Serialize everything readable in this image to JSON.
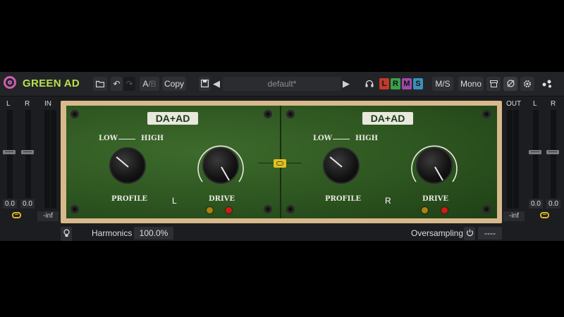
{
  "app": {
    "title": "GREEN AD"
  },
  "toolbar": {
    "ab_a": "A",
    "ab_sep": "/",
    "ab_b": "B",
    "copy_label": "Copy",
    "preset_name": "default*",
    "channels": [
      {
        "label": "L",
        "color": "#c0392b"
      },
      {
        "label": "R",
        "color": "#3aa04a"
      },
      {
        "label": "M",
        "color": "#a04aa8"
      },
      {
        "label": "S",
        "color": "#3a90b8"
      }
    ],
    "ms_label": "M/S",
    "mono_label": "Mono"
  },
  "input_meter": {
    "l": "L",
    "r": "R",
    "in": "IN",
    "l_value": "0.0",
    "r_value": "0.0",
    "in_value": "-inf"
  },
  "output_meter": {
    "out": "OUT",
    "l": "L",
    "r": "R",
    "l_value": "0.0",
    "r_value": "0.0",
    "out_value": "-inf"
  },
  "left_unit": {
    "badge": "DA+AD",
    "low": "LOW",
    "high": "HIGH",
    "profile_label": "PROFILE",
    "drive_label": "DRIVE",
    "channel": "L"
  },
  "right_unit": {
    "badge": "DA+AD",
    "low": "LOW",
    "high": "HIGH",
    "profile_label": "PROFILE",
    "drive_label": "DRIVE",
    "channel": "R"
  },
  "bottom": {
    "harmonics_label": "Harmonics",
    "harmonics_value": "100.0%",
    "oversampling_label": "Oversampling",
    "oversampling_value": "----"
  },
  "icons": [
    "folder-icon",
    "undo-icon",
    "redo-icon",
    "save-icon",
    "prev-preset-icon",
    "next-preset-icon",
    "headphones-icon",
    "archive-icon",
    "bypass-icon",
    "settings-icon",
    "share-icon",
    "link-icon",
    "chain-link-icon",
    "lightbulb-icon",
    "power-icon"
  ]
}
